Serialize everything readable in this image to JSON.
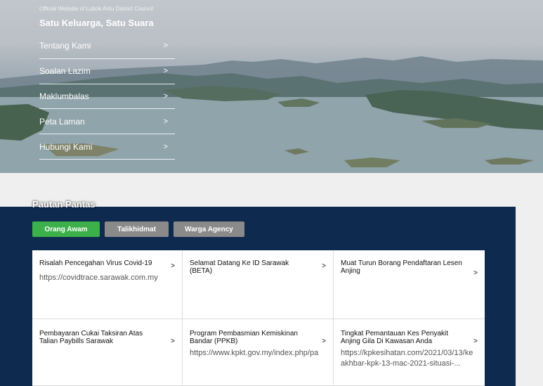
{
  "hero": {
    "tagline_small": "Official Website of Lubok Antu District Council",
    "tagline_big": "Satu Keluarga, Satu Suara"
  },
  "menu": {
    "items": [
      {
        "label": "Tentang Kami",
        "arrow": ">"
      },
      {
        "label": "Soalan Lazim",
        "arrow": ">"
      },
      {
        "label": "Maklumbalas",
        "arrow": ">"
      },
      {
        "label": "Peta Laman",
        "arrow": ">"
      },
      {
        "label": "Hubungi Kami",
        "arrow": ">"
      }
    ]
  },
  "quicklinks": {
    "title": "Pautan Pantas",
    "tabs": [
      "Orang Awam",
      "Talikhidmat",
      "Warga Agency"
    ],
    "cards": [
      {
        "title": "Risalah Pencegahan Virus Covid-19",
        "arrow": ">",
        "url": "https://covidtrace.sarawak.com.my",
        "url2": ""
      },
      {
        "title": "Selamat Datang Ke ID Sarawak (BETA)",
        "arrow": ">",
        "url": "",
        "url2": ""
      },
      {
        "title": "Muat Turun Borang Pendaftaran Lesen Anjing",
        "arrow": ">",
        "url": "",
        "url2": ""
      },
      {
        "title": "Pembayaran Cukai Taksiran Atas Talian Paybills Sarawak",
        "arrow": ">",
        "url": "",
        "url2": ""
      },
      {
        "title": "Program Pembasmian Kemiskinan Bandar (PPKB)",
        "arrow": ">",
        "url": "https://www.kpkt.gov.my/index.php/pa",
        "url2": ""
      },
      {
        "title": "Tingkat Pemantauan Kes Penyakit Anjing Gila Di Kawasan Anda",
        "arrow": ">",
        "url": "https://kpkesihatan.com/2021/03/13/ke",
        "url2": "akhbar-kpk-13-mac-2021-situasi-..."
      }
    ]
  }
}
